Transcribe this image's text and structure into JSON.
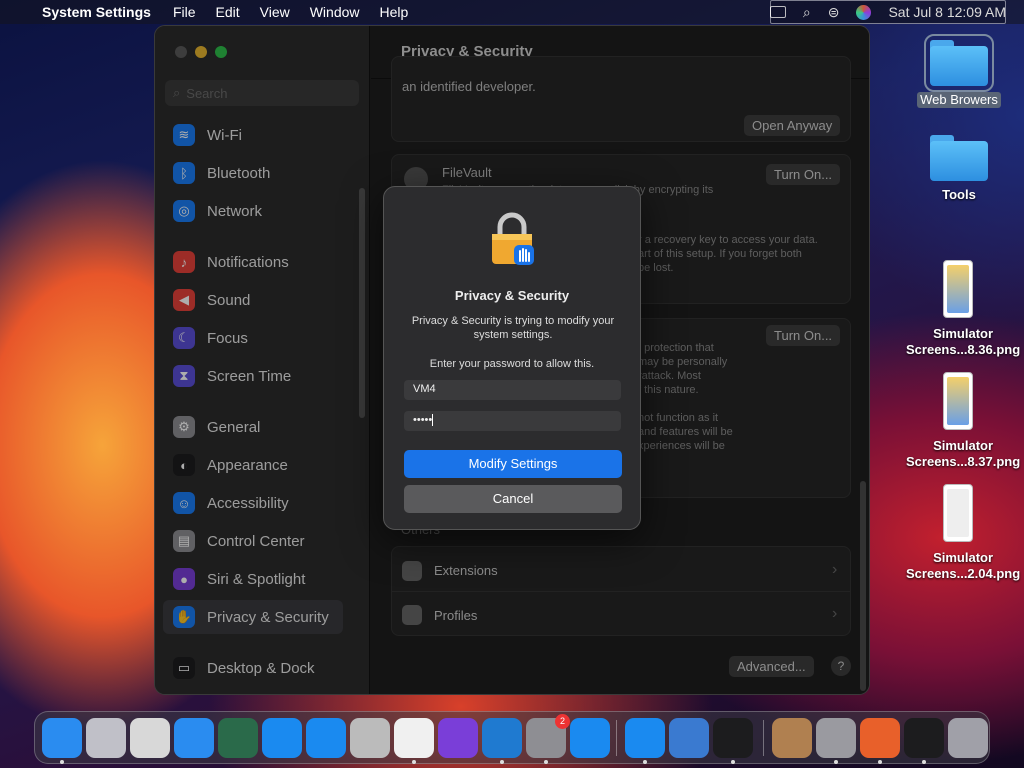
{
  "menubar": {
    "app_name": "System Settings",
    "menus": [
      "File",
      "Edit",
      "View",
      "Window",
      "Help"
    ],
    "clock": "Sat Jul 8  12:09 AM"
  },
  "window": {
    "title": "Privacy & Security",
    "search_placeholder": "Search",
    "sidebar": {
      "items": [
        {
          "label": "Wi-Fi",
          "icon": "wifi-icon",
          "color": "#1a7cf5"
        },
        {
          "label": "Bluetooth",
          "icon": "bluetooth-icon",
          "color": "#1a7cf5"
        },
        {
          "label": "Network",
          "icon": "globe-icon",
          "color": "#1a7cf5"
        },
        {
          "label": "Notifications",
          "icon": "bell-icon",
          "color": "#e6413a"
        },
        {
          "label": "Sound",
          "icon": "speaker-icon",
          "color": "#e6413a"
        },
        {
          "label": "Focus",
          "icon": "moon-icon",
          "color": "#5a4fd8"
        },
        {
          "label": "Screen Time",
          "icon": "hourglass-icon",
          "color": "#5a4fd8"
        },
        {
          "label": "General",
          "icon": "gear-icon",
          "color": "#8e8e93"
        },
        {
          "label": "Appearance",
          "icon": "appearance-icon",
          "color": "#1c1c1e"
        },
        {
          "label": "Accessibility",
          "icon": "accessibility-icon",
          "color": "#1a7cf5"
        },
        {
          "label": "Control Center",
          "icon": "control-center-icon",
          "color": "#8e8e93"
        },
        {
          "label": "Siri & Spotlight",
          "icon": "siri-icon",
          "color": "#7a3fd8"
        },
        {
          "label": "Privacy & Security",
          "icon": "hand-icon",
          "color": "#1a7cf5"
        },
        {
          "label": "Desktop & Dock",
          "icon": "desktop-icon",
          "color": "#1c1c1e"
        }
      ]
    },
    "main": {
      "developer_text": "an identified developer.",
      "open_anyway": "Open Anyway",
      "filevault_title": "FileVault",
      "filevault_desc": "FileVault secures the data on your disk by encrypting its",
      "filevault_text2": "r a recovery key to access your data.",
      "filevault_text3": "art of this setup. If you forget both",
      "filevault_text4": "be lost.",
      "turn_on": "Turn On...",
      "lockdown_lines": [
        "I protection that",
        "may be personally",
        "rattack. Most",
        "f this nature.",
        "",
        "not function as it",
        "and features will be",
        "xperiences will be"
      ],
      "others_label": "Others",
      "extensions": "Extensions",
      "profiles": "Profiles",
      "advanced": "Advanced...",
      "help": "?"
    }
  },
  "dialog": {
    "title": "Privacy & Security",
    "message": "Privacy & Security is trying to modify your system settings.",
    "prompt": "Enter your password to allow this.",
    "username": "VM4",
    "password_mask": "•••••",
    "modify_button": "Modify Settings",
    "cancel_button": "Cancel"
  },
  "desktop": {
    "icons": [
      {
        "label": "Web Browers",
        "type": "folder"
      },
      {
        "label": "Tools",
        "type": "folder"
      },
      {
        "label": "Simulator Screens...8.36.png",
        "type": "image"
      },
      {
        "label": "Simulator Screens...8.37.png",
        "type": "image"
      },
      {
        "label": "Simulator Screens...2.04.png",
        "type": "image"
      }
    ]
  },
  "dock": {
    "apps": [
      {
        "name": "finder-icon",
        "color": "#2a8cf0"
      },
      {
        "name": "launchpad-icon",
        "color": "#c0c0c8"
      },
      {
        "name": "script-editor-icon",
        "color": "#d8d8d8"
      },
      {
        "name": "safari-icon",
        "color": "#2a8cf0"
      },
      {
        "name": "time-machine-icon",
        "color": "#2a6a4a"
      },
      {
        "name": "xcode-icon",
        "color": "#1a8af0"
      },
      {
        "name": "app-store-icon",
        "color": "#1a8af0"
      },
      {
        "name": "automator-icon",
        "color": "#bbbbbb"
      },
      {
        "name": "chrome-icon",
        "color": "#f0f0f0"
      },
      {
        "name": "visual-studio-icon",
        "color": "#7a3ed8"
      },
      {
        "name": "vscode-icon",
        "color": "#1f7ad0"
      },
      {
        "name": "system-settings-icon",
        "color": "#8e8e93"
      },
      {
        "name": "simulator-icon",
        "color": "#1a8af0"
      },
      {
        "name": "app-store-2-icon",
        "color": "#1a8af0"
      },
      {
        "name": "instruments-icon",
        "color": "#3a7ad0"
      },
      {
        "name": "activity-monitor-icon",
        "color": "#1c1c1e"
      },
      {
        "name": "file-merge-icon",
        "color": "#b08050"
      },
      {
        "name": "disk-utility-icon",
        "color": "#9a9aa0"
      },
      {
        "name": "firefox-icon",
        "color": "#e8602a"
      },
      {
        "name": "console-icon",
        "color": "#1c1c1e"
      },
      {
        "name": "trash-icon",
        "color": "#a0a0a8"
      }
    ],
    "settings_badge": "2"
  }
}
